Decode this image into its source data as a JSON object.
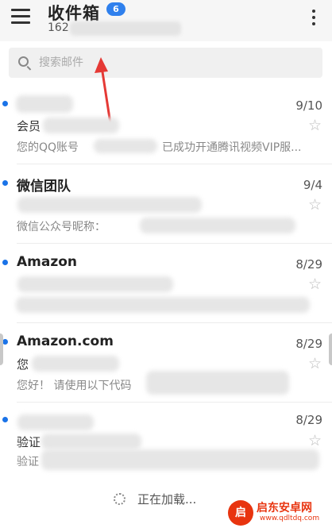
{
  "header": {
    "title": "收件箱",
    "unread_count": "6",
    "account_prefix": "162"
  },
  "search": {
    "placeholder": "搜索邮件",
    "value": ""
  },
  "mails": [
    {
      "sender": "",
      "date": "9/10",
      "subject": "会员",
      "preview": "您的QQ账号",
      "preview_tail": "已成功开通腾讯视频VIP服...",
      "unread": true
    },
    {
      "sender": "微信团队",
      "date": "9/4",
      "subject": "",
      "preview": "微信公众号昵称：",
      "preview_tail": "",
      "unread": true
    },
    {
      "sender": "Amazon",
      "date": "8/29",
      "subject": "",
      "preview": "",
      "preview_tail": "",
      "unread": true
    },
    {
      "sender": "Amazon.com",
      "date": "8/29",
      "subject": "您",
      "preview": "您好！ 请使用以下代码",
      "preview_tail": "",
      "unread": true
    },
    {
      "sender": "",
      "date": "8/29",
      "subject": "验证",
      "preview": "验证",
      "preview_tail": "",
      "unread": true
    }
  ],
  "footer": {
    "loading_text": "正在加载..."
  },
  "watermark": {
    "brand": "启东安卓网",
    "url": "www.qdltdq.com",
    "logo_glyph": "启"
  },
  "colors": {
    "accent": "#1a73e8",
    "badge": "#2f80ed",
    "annotation_arrow": "#e53935",
    "watermark": "#e8340f"
  }
}
